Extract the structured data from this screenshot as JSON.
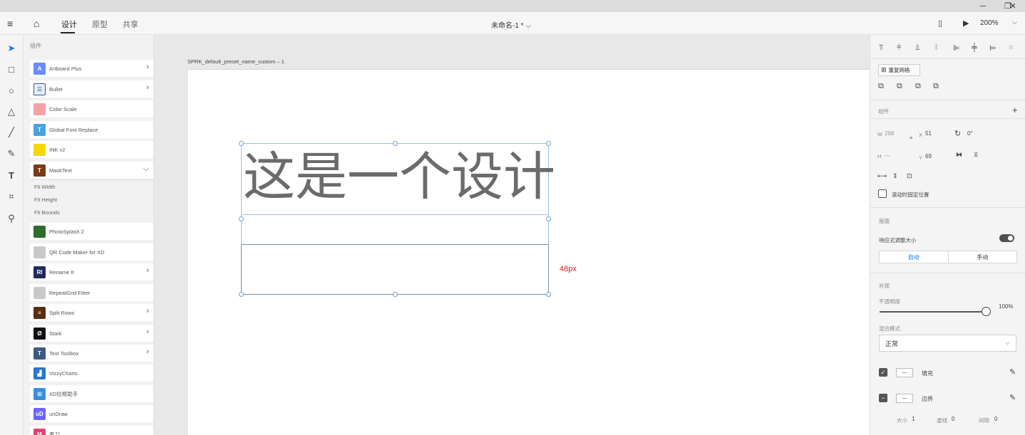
{
  "window": {
    "minimize": "─",
    "restore": "❐",
    "close": "✕"
  },
  "toolbar": {
    "menu_icon": "hamburger-icon",
    "home_icon": "home-icon",
    "tabs": [
      "设计",
      "原型",
      "共享"
    ],
    "active_tab": "设计",
    "doc_title": "未命名-1 *  ⌵",
    "device_icon": "phone-icon",
    "play_icon": "play-icon",
    "zoom": "200%"
  },
  "tools": [
    "select-icon",
    "rectangle-icon",
    "ellipse-icon",
    "triangle-icon",
    "line-icon",
    "pen-icon",
    "text-icon",
    "artboard-icon",
    "zoom-icon"
  ],
  "plugins": {
    "title": "插件",
    "items": [
      {
        "name": "Artboard Plus",
        "color": "#6a8cff",
        "glyph": "A",
        "chevron": true
      },
      {
        "name": "Bullet",
        "color": "#e8eef8",
        "glyph": "☰",
        "chevron": true
      },
      {
        "name": "Color Scale",
        "color": "#f3a3a3",
        "glyph": "",
        "chevron": false
      },
      {
        "name": "Global Font Replace",
        "color": "#4aa3df",
        "glyph": "T",
        "chevron": false
      },
      {
        "name": "INK v2",
        "color": "#f5d800",
        "glyph": "",
        "chevron": false
      },
      {
        "name": "MaskText",
        "color": "#7a3b18",
        "glyph": "T",
        "chevron": true
      },
      {
        "name": "PhotoSplash 2",
        "color": "#2f6d2a",
        "glyph": "",
        "chevron": false
      },
      {
        "name": "QR Code Maker for XD",
        "color": "#c9c9c9",
        "glyph": "",
        "chevron": false
      },
      {
        "name": "Rename It",
        "color": "#1f2b5a",
        "glyph": "RI",
        "chevron": true
      },
      {
        "name": "RepeatGrid Fitter",
        "color": "#c9c9c9",
        "glyph": "",
        "chevron": false
      },
      {
        "name": "Split Rows",
        "color": "#5a2c10",
        "glyph": "≡",
        "chevron": true
      },
      {
        "name": "Stark",
        "color": "#111111",
        "glyph": "Ø",
        "chevron": true
      },
      {
        "name": "Text Toolbox",
        "color": "#3d5a80",
        "glyph": "T",
        "chevron": true
      },
      {
        "name": "VizzyCharts",
        "color": "#2a78c8",
        "glyph": "▟",
        "chevron": false
      },
      {
        "name": "XD拉框助手",
        "color": "#3b8ed8",
        "glyph": "⊞",
        "chevron": false
      },
      {
        "name": "unDraw",
        "color": "#6c63ff",
        "glyph": "uD",
        "chevron": false
      },
      {
        "name": "墨刀",
        "color": "#e0456b",
        "glyph": "M",
        "chevron": false
      }
    ],
    "masktext_subitems": [
      "Fit Width",
      "Fit Height",
      "Fit Bounds"
    ]
  },
  "canvas": {
    "artboard_name": "SPRK_default_preset_name_custom – 1",
    "big_text": "这是一个设计",
    "measure": "48px"
  },
  "right_panel": {
    "repeat_grid": "重复网格",
    "component_label": "组件",
    "w_label": "W",
    "w_value": "288",
    "x_label": "X",
    "x_value": "51",
    "rotate_value": "0°",
    "h_label": "H",
    "h_value": "—",
    "y_label": "Y",
    "y_value": "69",
    "fix_position": "滚动时固定位置",
    "layout_label": "版面",
    "responsive": "响应式调整大小",
    "auto": "自动",
    "manual": "手动",
    "appearance_label": "外观",
    "opacity_label": "不透明度",
    "opacity_value": "100%",
    "blend_label": "混合模式",
    "blend_value": "正常",
    "fill_label": "填充",
    "border_label": "边界",
    "size_label": "大小",
    "size_value": "1",
    "dash_label": "虚线",
    "dash_value": "0",
    "gap_label": "间隙",
    "gap_value": "0"
  }
}
